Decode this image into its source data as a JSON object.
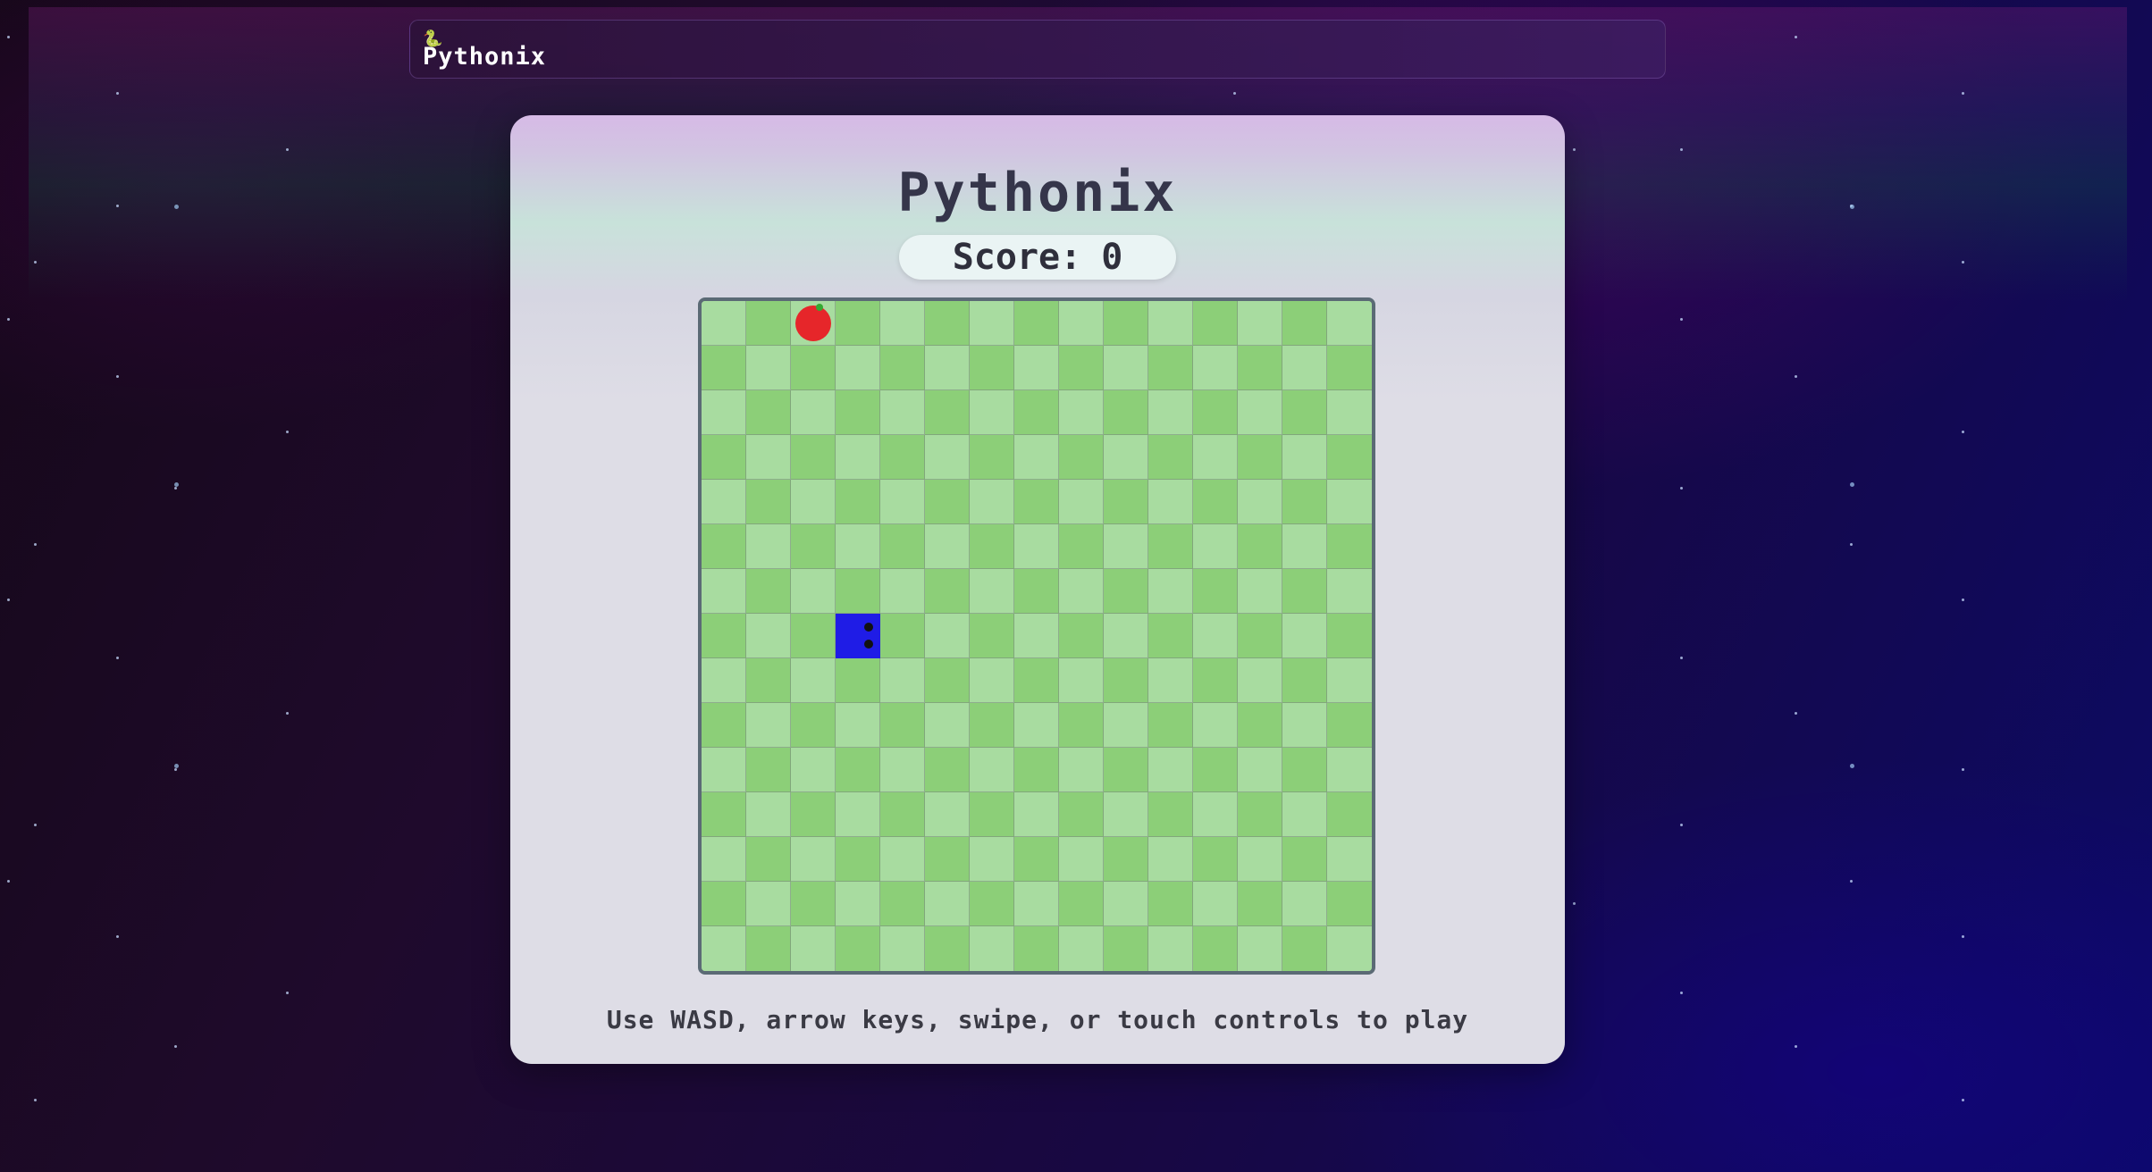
{
  "header": {
    "logo_icon": "🐍",
    "brand": "Pythonix"
  },
  "game": {
    "title": "Pythonix",
    "score_label": "Score:",
    "score_value": "0",
    "grid_size": 15,
    "apple": {
      "row": 0,
      "col": 2
    },
    "snake": [
      {
        "row": 7,
        "col": 3
      }
    ],
    "snake_direction": "right",
    "instructions": "Use WASD, arrow keys, swipe, or touch controls to play"
  },
  "colors": {
    "cell_light": "#a8dca0",
    "cell_dark": "#8ccf78",
    "snake": "#1f1ce6",
    "apple": "#e6262a"
  }
}
